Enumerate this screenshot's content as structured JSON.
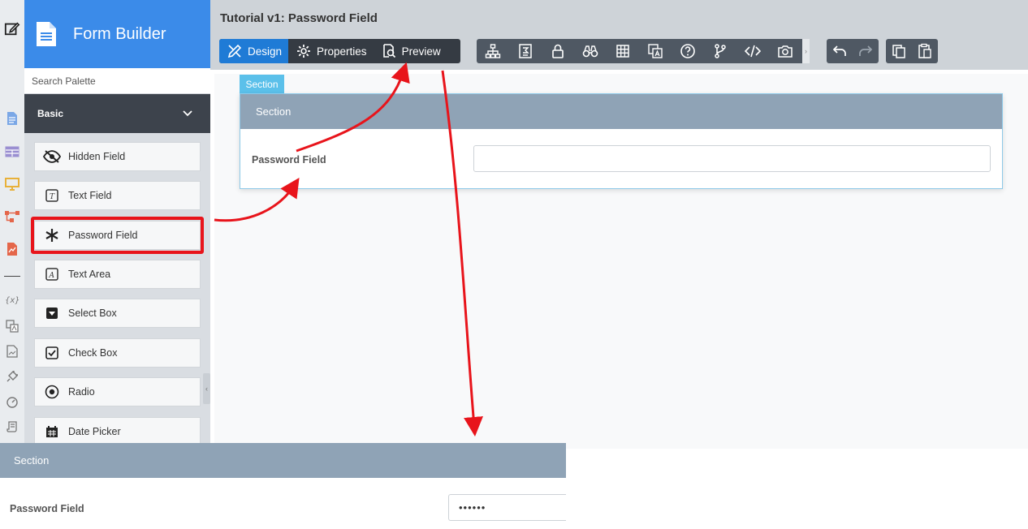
{
  "palette": {
    "title": "Form Builder",
    "search_placeholder": "Search Palette",
    "group_label": "Basic",
    "items": [
      {
        "label": "Hidden Field"
      },
      {
        "label": "Text Field"
      },
      {
        "label": "Password Field"
      },
      {
        "label": "Text Area"
      },
      {
        "label": "Select Box"
      },
      {
        "label": "Check Box"
      },
      {
        "label": "Radio"
      },
      {
        "label": "Date Picker"
      }
    ]
  },
  "header": {
    "title": "Tutorial v1: Password Field",
    "modes": [
      {
        "label": "Design"
      },
      {
        "label": "Properties"
      },
      {
        "label": "Preview"
      }
    ]
  },
  "canvas": {
    "section_tab": "Section",
    "section_header": "Section",
    "field_label": "Password Field"
  },
  "preview": {
    "section_header": "Section",
    "field_label": "Password Field",
    "field_value": "••••••"
  },
  "colors": {
    "brand": "#3b8be9",
    "active_mode": "#1f7bd6",
    "section_header": "#8fa3b6",
    "annotation": "#e8141b"
  }
}
